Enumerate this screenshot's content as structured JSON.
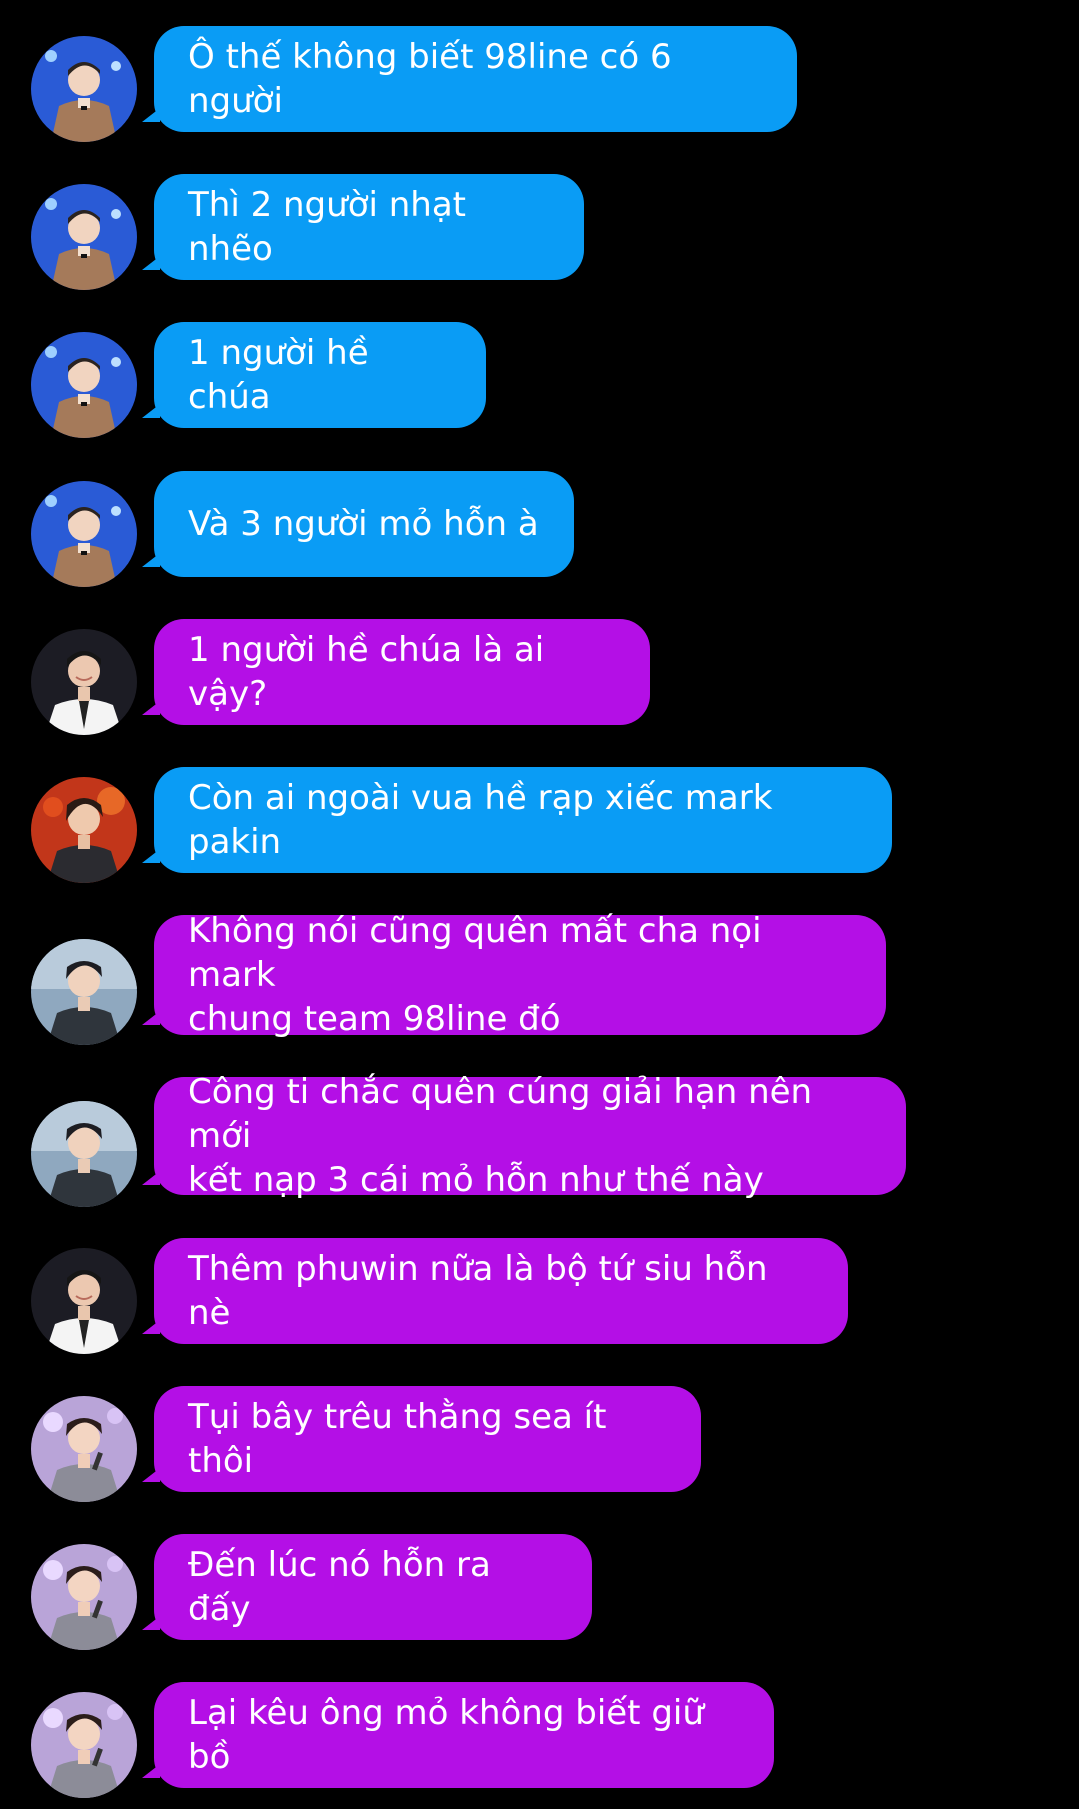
{
  "colors": {
    "background": "#000000",
    "incoming_blue": "#0a9cf5",
    "incoming_purple": "#b40fe6",
    "text": "#ffffff"
  },
  "messages": [
    {
      "avatar": "avatar-a",
      "color": "blue",
      "text": "Ô thế không biết 98line có 6 người"
    },
    {
      "avatar": "avatar-a",
      "color": "blue",
      "text": "Thì 2 người nhạt nhẽo"
    },
    {
      "avatar": "avatar-a",
      "color": "blue",
      "text": "1 người hề chúa"
    },
    {
      "avatar": "avatar-a",
      "color": "blue",
      "text": "Và 3 người mỏ hỗn à"
    },
    {
      "avatar": "avatar-b",
      "color": "purple",
      "text": "1 người hề chúa là ai vậy?"
    },
    {
      "avatar": "avatar-c",
      "color": "blue",
      "text": "Còn ai ngoài vua hề rạp xiếc mark pakin"
    },
    {
      "avatar": "avatar-d",
      "color": "purple",
      "text": "Không nói cũng quên mất cha nọi mark\nchung team 98line đó"
    },
    {
      "avatar": "avatar-d",
      "color": "purple",
      "text": "Công ti chắc quên cúng giải hạn nên mới\nkết nạp 3 cái mỏ hỗn như thế này"
    },
    {
      "avatar": "avatar-b",
      "color": "purple",
      "text": "Thêm phuwin nữa là bộ tứ siu hỗn nè"
    },
    {
      "avatar": "avatar-e",
      "color": "purple",
      "text": "Tụi bây trêu thằng sea ít thôi"
    },
    {
      "avatar": "avatar-e",
      "color": "purple",
      "text": "Đến lúc nó hỗn ra đấy"
    },
    {
      "avatar": "avatar-e",
      "color": "purple",
      "text": "Lại kêu ông mỏ không biết giữ bồ"
    }
  ]
}
